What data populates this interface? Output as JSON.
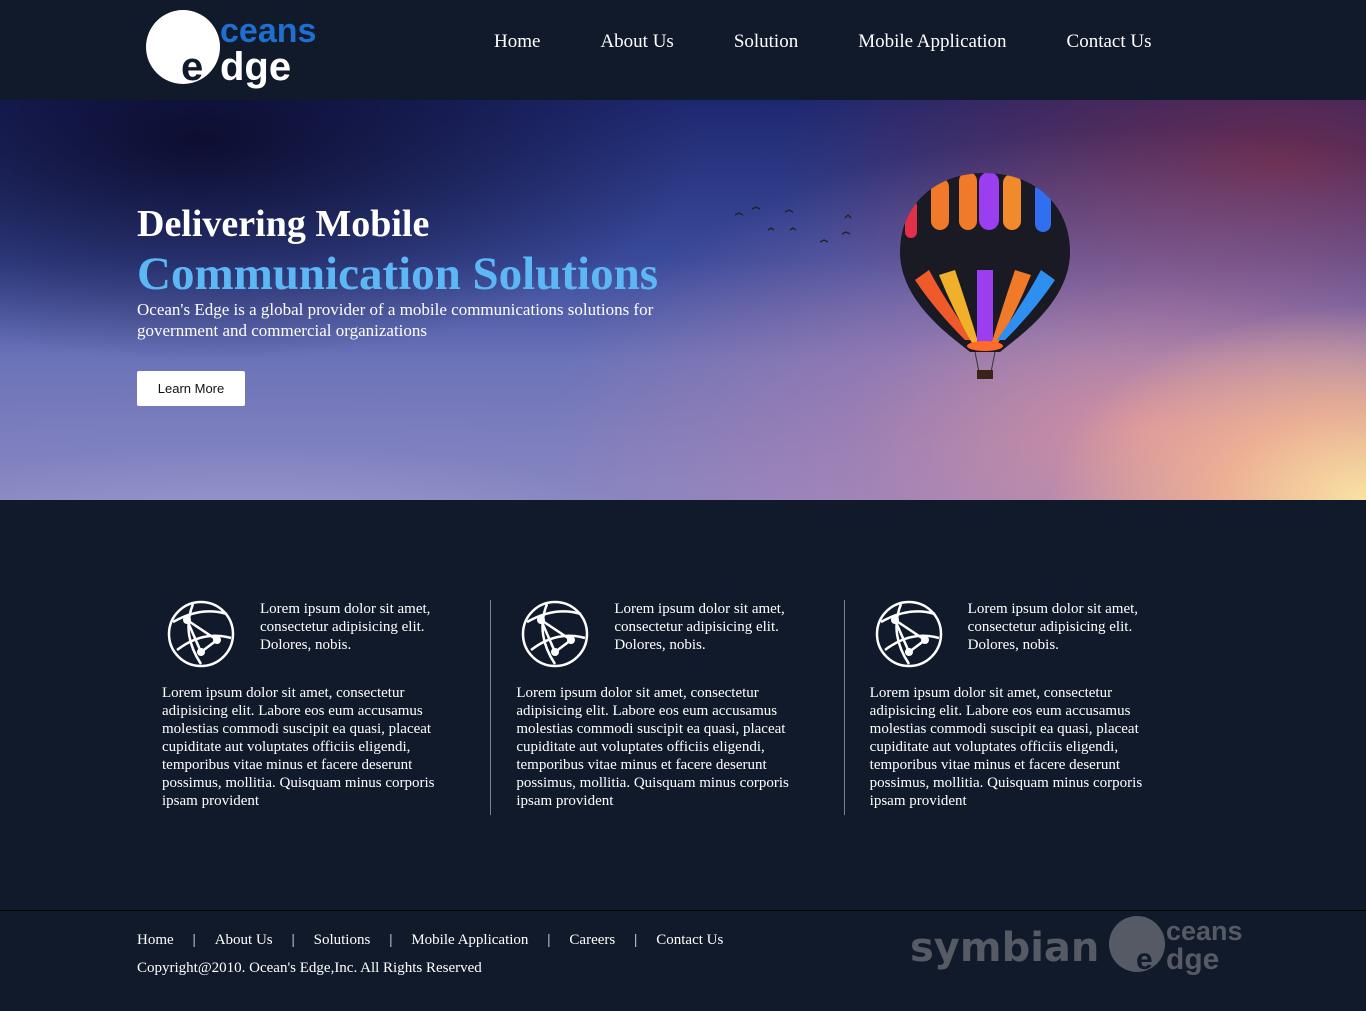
{
  "header": {
    "logo": {
      "top_text": "ceans",
      "bottom_text": "dge",
      "initial": "e"
    },
    "nav": [
      "Home",
      "About Us",
      "Solution",
      "Mobile Application",
      "Contact Us"
    ]
  },
  "hero": {
    "title_line1": "Delivering Mobile",
    "title_line2": "Communication Solutions",
    "description": "Ocean's Edge is a global provider of a mobile communications solutions for government and commercial organizations",
    "button_label": "Learn More"
  },
  "features": [
    {
      "icon": "globe-network-icon",
      "heading": "Lorem ipsum dolor sit amet, consectetur adipisicing elit. Dolores, nobis.",
      "body": "Lorem ipsum dolor sit amet, consectetur adipisicing elit. Labore eos eum accusamus molestias commodi suscipit ea quasi, placeat cupiditate aut voluptates officiis eligendi, temporibus vitae minus et facere deserunt possimus, mollitia. Quisquam minus corporis ipsam provident"
    },
    {
      "icon": "globe-network-icon",
      "heading": "Lorem ipsum dolor sit amet, consectetur adipisicing elit. Dolores, nobis.",
      "body": "Lorem ipsum dolor sit amet, consectetur adipisicing elit. Labore eos eum accusamus molestias commodi suscipit ea quasi, placeat cupiditate aut voluptates officiis eligendi, temporibus vitae minus et facere deserunt possimus, mollitia. Quisquam minus corporis ipsam provident"
    },
    {
      "icon": "globe-network-icon",
      "heading": "Lorem ipsum dolor sit amet, consectetur adipisicing elit. Dolores, nobis.",
      "body": "Lorem ipsum dolor sit amet, consectetur adipisicing elit. Labore eos eum accusamus molestias commodi suscipit ea quasi, placeat cupiditate aut voluptates officiis eligendi, temporibus vitae minus et facere deserunt possimus, mollitia. Quisquam minus corporis ipsam provident"
    }
  ],
  "footer": {
    "nav": [
      "Home",
      "About Us",
      "Solutions",
      "Mobile Application",
      "Careers",
      "Contact Us"
    ],
    "copyright": "Copyright@2010. Ocean's Edge,Inc. All Rights Reserved",
    "partner_logo_text": "symbian",
    "logo": {
      "top_text": "ceans",
      "bottom_text": "dge",
      "initial": "e"
    }
  },
  "colors": {
    "background": "#111a2b",
    "accent": "#5cb8f5",
    "logo_blue": "#1e6fd0",
    "footer_logo_gray": "#555a65"
  }
}
